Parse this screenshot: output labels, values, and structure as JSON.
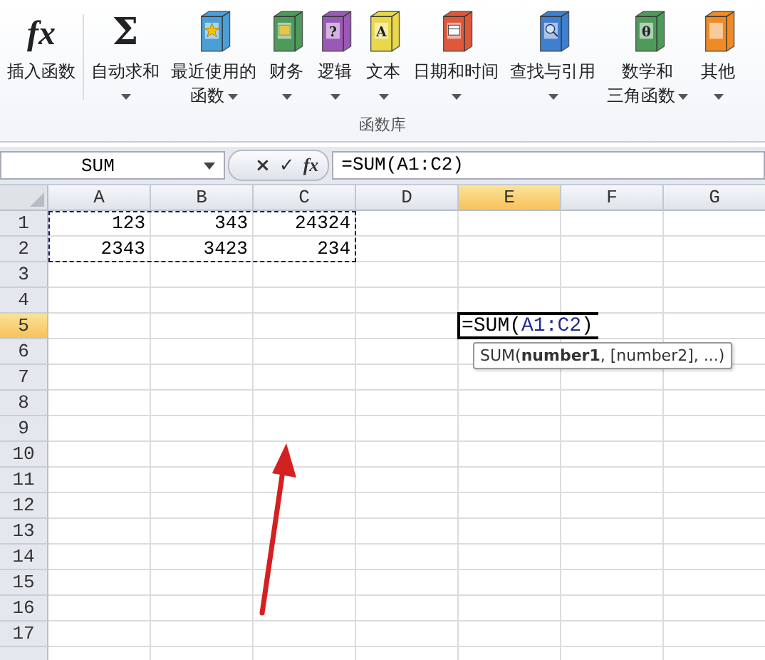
{
  "ribbon": {
    "buttons": [
      {
        "lines": [
          "插入函数"
        ],
        "dropdown": false,
        "icon": {
          "kind": "fx",
          "glyph": "fx"
        }
      },
      {
        "lines": [
          "自动求和"
        ],
        "dropdown": true,
        "icon": {
          "kind": "sigma",
          "glyph": "Σ"
        }
      },
      {
        "lines": [
          "最近使用的",
          "函数"
        ],
        "dropdown": true,
        "icon": {
          "kind": "star-book",
          "color": "#4a9fd8"
        }
      },
      {
        "lines": [
          "财务"
        ],
        "dropdown": true,
        "icon": {
          "kind": "money-book",
          "color": "#4e9a5a"
        }
      },
      {
        "lines": [
          "逻辑"
        ],
        "dropdown": true,
        "icon": {
          "kind": "letter-book",
          "color": "#9b59b6",
          "glyph": "?"
        }
      },
      {
        "lines": [
          "文本"
        ],
        "dropdown": true,
        "icon": {
          "kind": "letter-book",
          "color": "#e8d84a",
          "glyph": "A"
        }
      },
      {
        "lines": [
          "日期和时间"
        ],
        "dropdown": true,
        "icon": {
          "kind": "calendar-book",
          "color": "#e0583a"
        }
      },
      {
        "lines": [
          "查找与引用"
        ],
        "dropdown": true,
        "icon": {
          "kind": "search-book",
          "color": "#3f7fcf"
        }
      },
      {
        "lines": [
          "数学和",
          "三角函数"
        ],
        "dropdown": true,
        "icon": {
          "kind": "letter-book",
          "color": "#4e9a5a",
          "glyph": "θ"
        }
      },
      {
        "lines": [
          "其他"
        ],
        "dropdown": true,
        "icon": {
          "kind": "plain-book",
          "color": "#f08a24"
        }
      }
    ],
    "group_label": "函数库"
  },
  "formula_bar": {
    "name_box": "SUM",
    "buttons": [
      "×",
      "✓",
      "fx"
    ],
    "formula": "=SUM(A1:C2)"
  },
  "sheet": {
    "columns": [
      {
        "label": "A",
        "selected": false
      },
      {
        "label": "B",
        "selected": false
      },
      {
        "label": "C",
        "selected": false
      },
      {
        "label": "D",
        "selected": false
      },
      {
        "label": "E",
        "selected": true
      },
      {
        "label": "F",
        "selected": false
      },
      {
        "label": "G",
        "selected": false
      }
    ],
    "rows": [
      {
        "label": "1",
        "selected": false,
        "cells": [
          {
            "kind": "value",
            "text": "123",
            "marked": true
          },
          {
            "kind": "value",
            "text": "343",
            "marked": true
          },
          {
            "kind": "value",
            "text": "24324",
            "marked": true
          }
        ]
      },
      {
        "label": "2",
        "selected": false,
        "cells": [
          {
            "kind": "value",
            "text": "2343",
            "marked": true
          },
          {
            "kind": "value",
            "text": "3423",
            "marked": true
          },
          {
            "kind": "value",
            "text": "234",
            "marked": true
          }
        ]
      },
      {
        "label": "3",
        "selected": false,
        "cells": []
      },
      {
        "label": "4",
        "selected": false,
        "cells": []
      },
      {
        "label": "5",
        "selected": true,
        "cells": [
          {
            "kind": "empty"
          },
          {
            "kind": "empty"
          },
          {
            "kind": "empty"
          },
          {
            "kind": "empty"
          },
          {
            "kind": "editor",
            "parts": [
              {
                "text": "=SUM(",
                "ref": false
              },
              {
                "text": "A1:C2",
                "ref": true
              },
              {
                "text": ")",
                "ref": false
              }
            ],
            "tooltip": "SUM(**number1**, [number2], ...)"
          }
        ]
      },
      {
        "label": "6",
        "selected": false,
        "cells": []
      },
      {
        "label": "7",
        "selected": false,
        "cells": []
      },
      {
        "label": "8",
        "selected": false,
        "cells": []
      },
      {
        "label": "9",
        "selected": false,
        "cells": []
      },
      {
        "label": "10",
        "selected": false,
        "cells": []
      },
      {
        "label": "11",
        "selected": false,
        "cells": []
      },
      {
        "label": "12",
        "selected": false,
        "cells": []
      },
      {
        "label": "13",
        "selected": false,
        "cells": []
      },
      {
        "label": "14",
        "selected": false,
        "cells": []
      },
      {
        "label": "15",
        "selected": false,
        "cells": []
      },
      {
        "label": "16",
        "selected": false,
        "cells": []
      },
      {
        "label": "17",
        "selected": false,
        "cells": []
      }
    ]
  }
}
